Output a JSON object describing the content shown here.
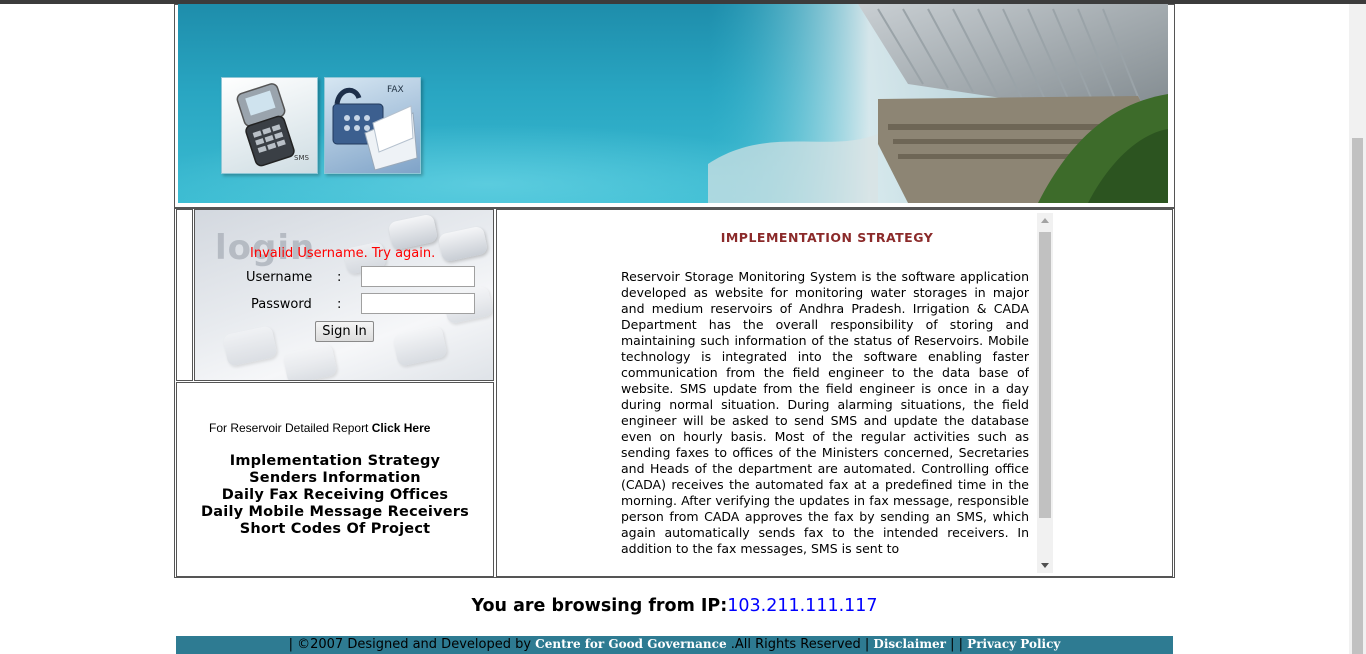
{
  "login": {
    "error": "Invalid Username. Try again.",
    "username_label": "Username",
    "password_label": "Password",
    "colon": ":",
    "username_value": "",
    "password_value": "",
    "signin_label": "Sign In",
    "watermark": "login"
  },
  "banner": {
    "sms_tag": "SMS",
    "fax_tag": "FAX"
  },
  "sidebar": {
    "report_text": "For Reservoir Detailed Report",
    "report_link": "Click Here",
    "links": [
      "Implementation Strategy",
      "Senders Information",
      "Daily Fax Receiving Offices",
      "Daily Mobile Message Receivers",
      "Short Codes Of Project"
    ]
  },
  "content": {
    "title": "IMPLEMENTATION STRATEGY",
    "body": "Reservoir Storage Monitoring System is the software application developed as website for monitoring water storages in major and medium reservoirs of Andhra Pradesh. Irrigation & CADA Department has the overall responsibility of storing and maintaining such information of the status of Reservoirs. Mobile technology is integrated into the software enabling faster communication from the field engineer to the data base of website. SMS update from the field engineer is once in a day during normal situation. During alarming situations, the field engineer will be asked to send SMS and update the database even on hourly basis. Most of the regular activities such as sending faxes to offices of the Ministers concerned, Secretaries and Heads of the department are automated. Controlling office (CADA) receives the automated fax at a predefined time in the morning. After verifying the updates in fax message, responsible person from CADA approves the fax by sending an SMS, which again automatically sends fax to the intended receivers. In addition to the fax messages, SMS is sent to"
  },
  "ip": {
    "label": "You are browsing from IP:",
    "value": "103.211.111.117"
  },
  "footer": {
    "sep_start": "| ",
    "copyright": "©2007 Designed and Developed by ",
    "org": "Centre for Good Governance",
    "rights": " .All Rights Reserved ",
    "sep1": "| ",
    "disclaimer": "Disclaimer",
    "sep2": " | | ",
    "privacy": "Privacy Policy"
  },
  "colors": {
    "error": "#ff0000",
    "title": "#8b2a2a",
    "ip": "#0000ff",
    "footer_bg": "#2e7b92"
  }
}
